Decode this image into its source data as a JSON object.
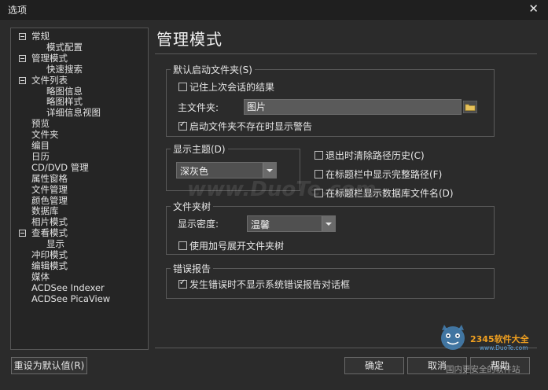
{
  "window": {
    "title": "选项",
    "close": "✕"
  },
  "tree": [
    {
      "label": "常规",
      "indent": 0,
      "expander": true
    },
    {
      "label": "模式配置",
      "indent": 2,
      "expander": false
    },
    {
      "label": "管理模式",
      "indent": 0,
      "expander": true
    },
    {
      "label": "快速搜索",
      "indent": 2,
      "expander": false
    },
    {
      "label": "文件列表",
      "indent": 0,
      "expander": true
    },
    {
      "label": "略图信息",
      "indent": 2,
      "expander": false
    },
    {
      "label": "略图样式",
      "indent": 2,
      "expander": false
    },
    {
      "label": "详细信息视图",
      "indent": 2,
      "expander": false
    },
    {
      "label": "预览",
      "indent": 0,
      "expander": false
    },
    {
      "label": "文件夹",
      "indent": 0,
      "expander": false
    },
    {
      "label": "编目",
      "indent": 0,
      "expander": false
    },
    {
      "label": "日历",
      "indent": 0,
      "expander": false
    },
    {
      "label": "CD/DVD 管理",
      "indent": 0,
      "expander": false
    },
    {
      "label": "属性窗格",
      "indent": 0,
      "expander": false
    },
    {
      "label": "文件管理",
      "indent": 0,
      "expander": false
    },
    {
      "label": "颜色管理",
      "indent": 0,
      "expander": false
    },
    {
      "label": "数据库",
      "indent": 0,
      "expander": false
    },
    {
      "label": "相片模式",
      "indent": 0,
      "expander": false
    },
    {
      "label": "查看模式",
      "indent": 0,
      "expander": true
    },
    {
      "label": "显示",
      "indent": 2,
      "expander": false
    },
    {
      "label": "冲印模式",
      "indent": 0,
      "expander": false
    },
    {
      "label": "编辑模式",
      "indent": 0,
      "expander": false
    },
    {
      "label": "媒体",
      "indent": 0,
      "expander": false
    },
    {
      "label": "ACDSee Indexer",
      "indent": 0,
      "expander": false
    },
    {
      "label": "ACDSee PicaView",
      "indent": 0,
      "expander": false
    }
  ],
  "heading": "管理模式",
  "startup": {
    "group_title": "默认启动文件夹(S)",
    "remember_label": "记住上次会话的结果",
    "remember_checked": false,
    "home_label": "主文件夹:",
    "home_value": "图片",
    "warn_label": "启动文件夹不存在时显示警告",
    "warn_checked": true
  },
  "theme": {
    "group_title": "显示主题(D)",
    "value": "深灰色"
  },
  "options": {
    "clear_history": "退出时清除路径历史(C)",
    "full_path": "在标题栏中显示完整路径(F)",
    "db_name": "在标题栏显示数据库文件名(D)"
  },
  "folder_tree": {
    "group_title": "文件夹树",
    "density_label": "显示密度:",
    "density_value": "温馨",
    "plus_label": "使用加号展开文件夹树"
  },
  "errors": {
    "group_title": "错误报告",
    "suppress_label": "发生错误时不显示系统错误报告对话框",
    "suppress_checked": true
  },
  "buttons": {
    "reset": "重设为默认值(R)",
    "ok": "确定",
    "cancel": "取消",
    "help": "帮助"
  },
  "watermarks": {
    "duote": "www.DuoTe.com",
    "brand": "2345软件大全",
    "brand_url": "www.DuoTe.com",
    "brand_sub": "国内更安全的软件站"
  }
}
